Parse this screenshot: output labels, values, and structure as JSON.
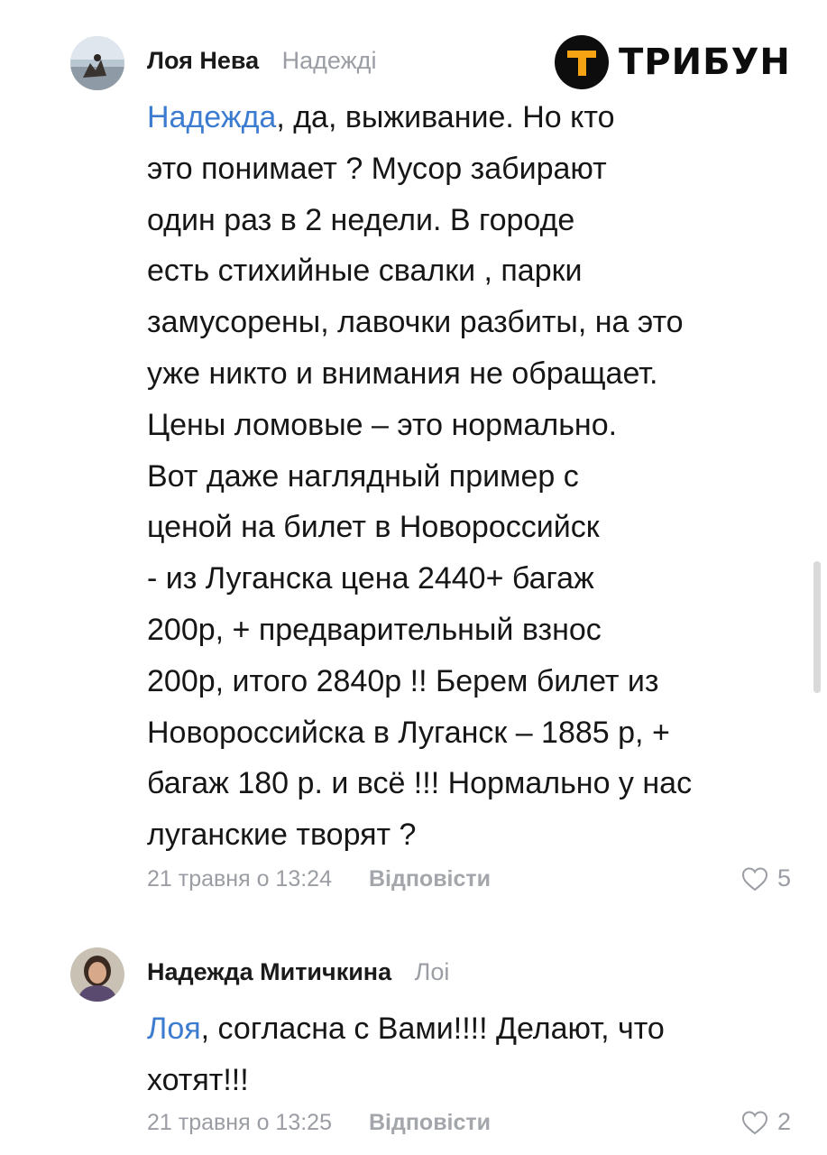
{
  "brand": {
    "logo_text": "ТРИБУН",
    "logo_letter": "Т",
    "accent": "#f5a312"
  },
  "comments": [
    {
      "author": "Лоя Нева",
      "reply_to": "Надежді",
      "mention": "Надежда",
      "lines": [
        ", да, выживание. Но кто",
        "это понимает ? Мусор забирают",
        "один раз в 2 недели. В городе",
        "есть стихийные свалки , парки",
        "замусорены, лавочки разбиты, на это",
        "уже никто и внимания не обращает.",
        "Цены ломовые  – это нормально.",
        "Вот даже наглядный пример с",
        "ценой на билет в Новороссийск",
        "- из Луганска цена 2440+ багаж",
        "200р, + предварительный взнос",
        "200р, итого 2840р !! Берем билет из",
        "Новороссийска в Луганск –  1885 р, +",
        "багаж 180 р. и всё !!! Нормально у нас",
        "луганские творят ?"
      ],
      "timestamp": "21 травня о 13:24",
      "reply_label": "Відповісти",
      "likes": "5"
    },
    {
      "author": "Надежда Митичкина",
      "reply_to": "Лоі",
      "mention": "Лоя",
      "lines": [
        ", согласна с Вами!!!! Делают, что",
        "хотят!!!"
      ],
      "timestamp": "21 травня о 13:25",
      "reply_label": "Відповісти",
      "likes": "2"
    }
  ]
}
